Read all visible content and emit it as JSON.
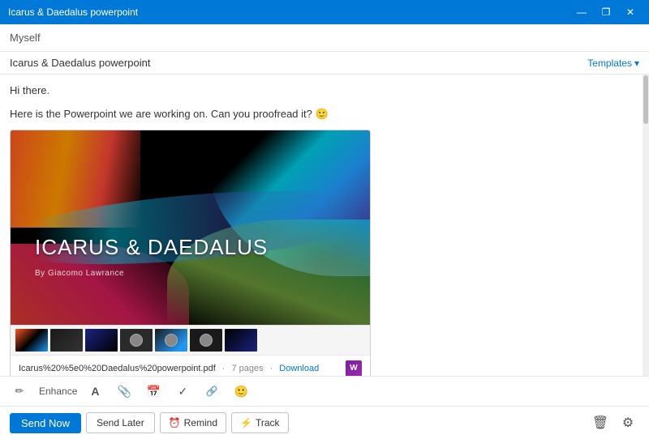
{
  "titleBar": {
    "title": "Icarus & Daedalus powerpoint",
    "minBtn": "—",
    "maxBtn": "❐",
    "closeBtn": "✕"
  },
  "toField": {
    "label": "",
    "value": "Myself"
  },
  "subjectField": {
    "value": "Icarus & Daedalus powerpoint",
    "templatesBtn": "Templates"
  },
  "body": {
    "greeting": "Hi there.",
    "message": "Here is the Powerpoint we are working on. Can you proofread it? 🙂"
  },
  "attachment": {
    "slideTitle": "ICARUS & DAEDALUS",
    "slideSubtitle": "By Giacomo Lawrance",
    "fileName": "Icarus%20%5e0%20Daedalus%20powerpoint.pdf",
    "pageCount": "7 pages",
    "downloadLink": "Download"
  },
  "toolbar": {
    "enhanceLabel": "Enhance",
    "icons": [
      "pencil",
      "A",
      "paperclip",
      "calendar",
      "check",
      "smiley"
    ]
  },
  "actionBar": {
    "sendNow": "Send Now",
    "sendLater": "Send Later",
    "remind": "Remind",
    "track": "Track"
  }
}
